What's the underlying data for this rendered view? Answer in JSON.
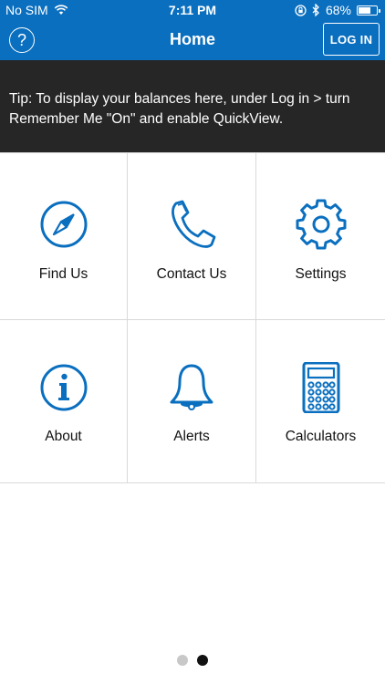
{
  "status_bar": {
    "carrier": "No SIM",
    "time": "7:11 PM",
    "battery": "68%",
    "battery_level": 0.68
  },
  "nav": {
    "help_label": "?",
    "title": "Home",
    "login_label": "LOG IN"
  },
  "tip": {
    "text": "Tip: To display your balances here, under Log in > turn Remember Me \"On\" and enable QuickView."
  },
  "menu": {
    "items": [
      {
        "label": "Find Us",
        "icon": "compass-icon"
      },
      {
        "label": "Contact Us",
        "icon": "phone-icon"
      },
      {
        "label": "Settings",
        "icon": "gear-icon"
      },
      {
        "label": "About",
        "icon": "info-icon"
      },
      {
        "label": "Alerts",
        "icon": "bell-icon"
      },
      {
        "label": "Calculators",
        "icon": "calculator-icon"
      }
    ]
  },
  "pager": {
    "pages": 2,
    "active_index": 1
  },
  "colors": {
    "nav_bg": "#0a6fbf",
    "tip_bg": "#262626",
    "icon": "#0a6fbf"
  }
}
